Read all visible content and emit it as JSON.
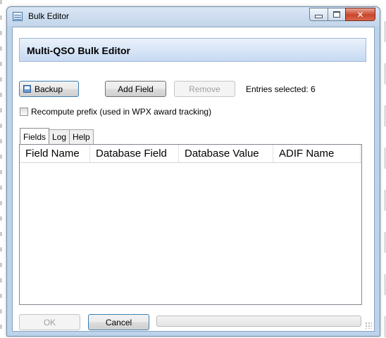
{
  "window": {
    "title": "Bulk Editor"
  },
  "header": {
    "title": "Multi-QSO Bulk Editor"
  },
  "toolbar": {
    "backup_label": "Backup",
    "add_field_label": "Add Field",
    "remove_label": "Remove",
    "entries_selected": "Entries selected: 6"
  },
  "options": {
    "recompute_prefix_label": "Recompute prefix (used in WPX award tracking)",
    "recompute_prefix_checked": false
  },
  "tabs": [
    {
      "label": "Fields",
      "active": true
    },
    {
      "label": "Log",
      "active": false
    },
    {
      "label": "Help",
      "active": false
    }
  ],
  "table": {
    "columns": [
      "Field Name",
      "Database Field",
      "Database Value",
      "ADIF Name"
    ],
    "rows": []
  },
  "footer": {
    "ok_label": "OK",
    "cancel_label": "Cancel",
    "progress": 0
  },
  "colors": {
    "header_band": "#c6daf2",
    "window_frame": "#bcd3ec",
    "close_button": "#c9462c"
  },
  "icons": {
    "app": "window-icon",
    "backup": "floppy-disk-icon"
  }
}
